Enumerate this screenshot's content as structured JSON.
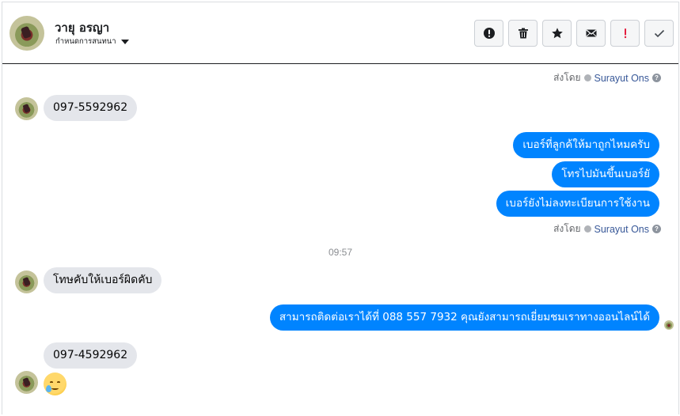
{
  "header": {
    "contact_name": "วายุ อรญา",
    "status_label": "กำหนดการสนทนา",
    "toolbar": [
      {
        "name": "alert-button",
        "icon": "exclamation-circle-icon"
      },
      {
        "name": "delete-button",
        "icon": "trash-icon"
      },
      {
        "name": "star-button",
        "icon": "star-icon"
      },
      {
        "name": "mail-button",
        "icon": "envelope-icon"
      },
      {
        "name": "important-button",
        "icon": "red-exclamation-icon"
      },
      {
        "name": "done-button",
        "icon": "check-icon"
      }
    ]
  },
  "meta": {
    "sent_by_label": "ส่งโดย",
    "sent_by_name": "Surayut Ons",
    "help_glyph": "?"
  },
  "messages": {
    "m1": "097-5592962",
    "m2": "เบอร์ที่ลูกค้ให้มาถูกไหมครับ",
    "m3": "โทรไปมันขึ้นเบอร์ยั",
    "m4": "เบอร์ยังไม่ลงทะเบียนการใช้งาน",
    "time": "09:57",
    "m5": "โทษคับให้เบอร์ผิดคับ",
    "m6": "สามารถติดต่อเราได้ที่ 088 557 7932 คุณยังสามารถเยี่ยมชมเราทางออนไลน์ได้",
    "m7": "097-4592962",
    "m8_emoji": "face-holding-back-tears-emoji"
  },
  "colors": {
    "outgoing_bubble": "#0084ff",
    "incoming_bubble": "#e4e6eb",
    "important_red": "#e41e3f"
  }
}
